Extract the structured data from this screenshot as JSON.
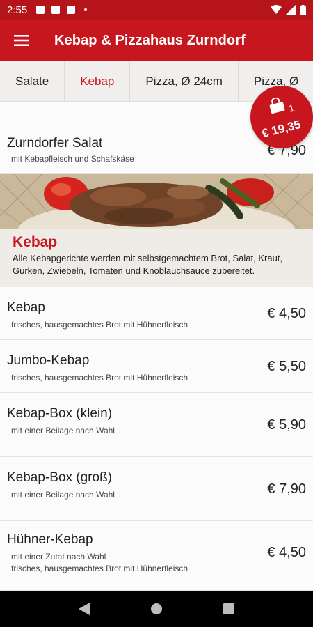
{
  "status_bar": {
    "time": "2:55"
  },
  "app_bar": {
    "title": "Kebap & Pizzahaus Zurndorf"
  },
  "tabs": [
    {
      "label": "Salate"
    },
    {
      "label": "Kebap"
    },
    {
      "label": "Pizza, Ø 24cm"
    },
    {
      "label": "Pizza, Ø"
    }
  ],
  "active_tab": "Kebap",
  "cart": {
    "count": "1",
    "total": "€ 19,35"
  },
  "previous_item": {
    "name": "Zurndorfer Salat",
    "desc": "mit Kebapfleisch und Schafskäse",
    "price": "€ 7,90"
  },
  "section": {
    "title": "Kebap",
    "text": "Alle Kebapgerichte werden mit selbstgemachtem Brot, Salat, Kraut, Gurken, Zwiebeln, Tomaten und Knoblauchsauce zubereitet."
  },
  "items": [
    {
      "name": "Kebap",
      "desc1": "frisches, hausgemachtes Brot mit Hühnerfleisch",
      "desc2": "",
      "price": "€ 4,50"
    },
    {
      "name": "Jumbo-Kebap",
      "desc1": "frisches, hausgemachtes Brot mit Hühnerfleisch",
      "desc2": "",
      "price": "€ 5,50"
    },
    {
      "name": "Kebap-Box (klein)",
      "desc1": "mit einer Beilage nach Wahl",
      "desc2": "",
      "price": "€ 5,90"
    },
    {
      "name": "Kebap-Box (groß)",
      "desc1": "mit einer Beilage nach Wahl",
      "desc2": "",
      "price": "€ 7,90"
    },
    {
      "name": "Hühner-Kebap",
      "desc1": "mit einer Zutat nach Wahl",
      "desc2": "frisches, hausgemachtes Brot mit Hühnerfleisch",
      "price": "€ 4,50"
    }
  ],
  "colors": {
    "brand_red": "#c7161e",
    "status_red": "#b5141b",
    "section_bg": "#efece8"
  },
  "icons": {
    "menu": "hamburger-menu-icon",
    "cart": "shopping-bag-icon",
    "back": "back-triangle-icon",
    "home": "home-circle-icon",
    "recents": "recents-square-icon"
  }
}
